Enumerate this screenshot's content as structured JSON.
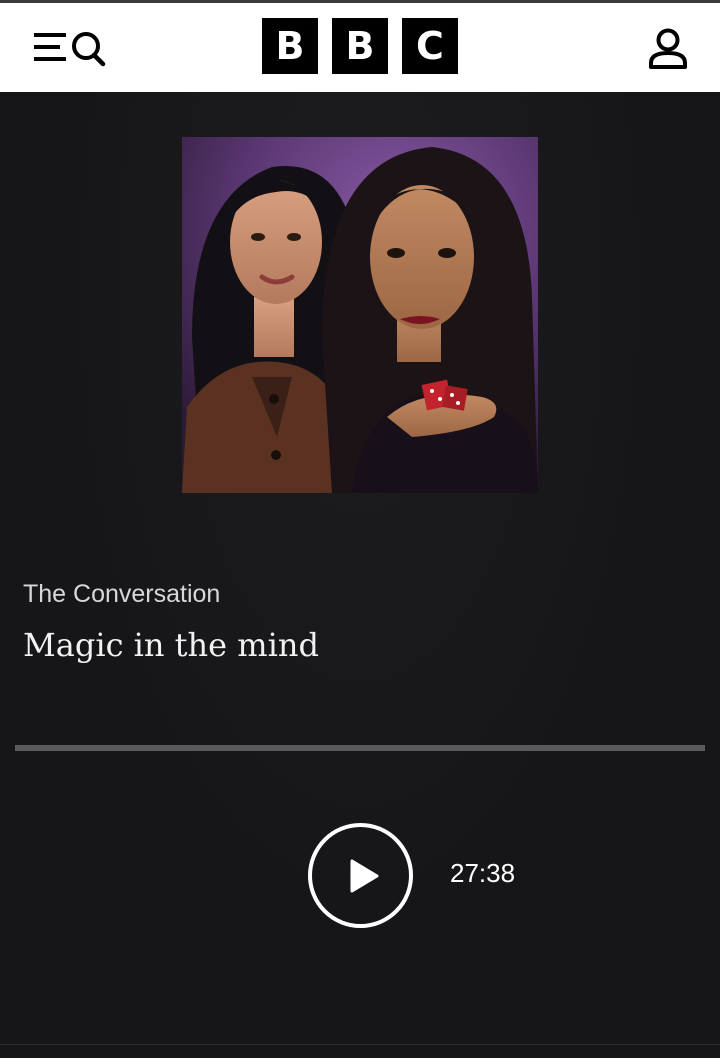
{
  "header": {
    "logo_letters": [
      "B",
      "B",
      "C"
    ],
    "menu_icon": "menu-search-icon",
    "account_icon": "account-icon"
  },
  "episode": {
    "series_title": "The Conversation",
    "episode_title": "Magic in the mind",
    "artwork": "two women smiling, one holding red dice, purple background",
    "duration": "27:38",
    "progress": 0
  },
  "player": {
    "play_icon": "play-icon"
  },
  "colors": {
    "background": "#161618",
    "header_bg": "#ffffff",
    "logo_block": "#000000",
    "text": "#ffffff",
    "progress_track": "#5a5a5c"
  }
}
